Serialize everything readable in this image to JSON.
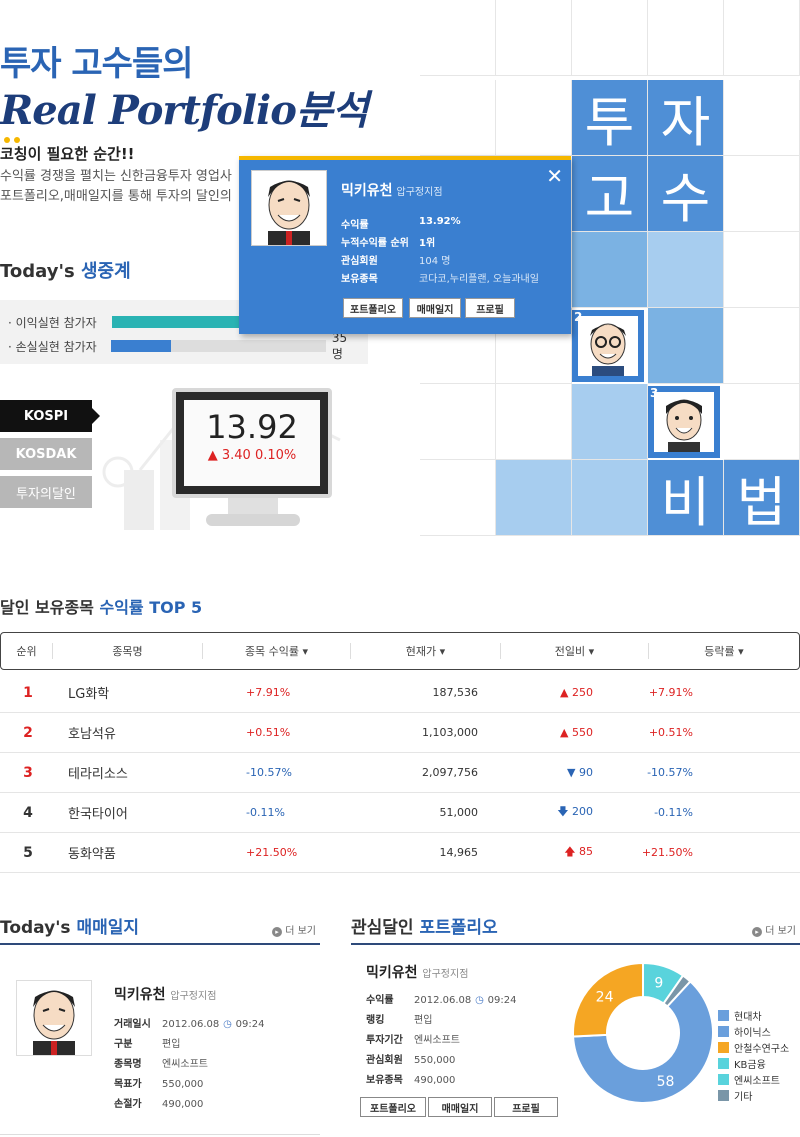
{
  "hero": {
    "title_line1": "투자 고수들의",
    "title_line2": "Real Portfolio분석",
    "coaching": "코칭이 필요한 순간!!",
    "intro_line1": "수익률 경쟁을 펼치는 신한금융투자 영업사",
    "intro_line2": "포트폴리오,매매일지를 통해 투자의 달인의"
  },
  "today_live": {
    "title_prefix": "Today's",
    "title_accent": "생중계",
    "profit_label": "· 이익실현 참가자",
    "loss_label": "· 손실실현 참가자",
    "loss_count": "35명",
    "profit_ratio": 0.6,
    "loss_ratio": 0.28
  },
  "market": {
    "tabs": [
      "KOSPI",
      "KOSDAK",
      "투자의달인"
    ],
    "active_tab": "KOSPI",
    "value": "13.92",
    "change": "▲ 3.40  0.10%"
  },
  "grid_chars": [
    "투",
    "자",
    "고",
    "수",
    "비",
    "법"
  ],
  "rank_cards": [
    {
      "num": "2"
    },
    {
      "num": "3"
    }
  ],
  "popup": {
    "name": "믹키유천",
    "branch": "압구정지점",
    "rows": [
      {
        "k": "수익률",
        "v": "13.92%"
      },
      {
        "k": "누적수익률 순위",
        "v": "1위"
      },
      {
        "k": "관심회원",
        "v": "104 명"
      },
      {
        "k": "보유종목",
        "v": "코다코,누리플랜, 오늘과내일"
      }
    ],
    "buttons": [
      "포트폴리오",
      "매매일지",
      "프로필"
    ]
  },
  "top5": {
    "title_prefix": "달인 보유종목",
    "title_accent": "수익률 TOP 5",
    "headers": [
      "순위",
      "종목명",
      "종목 수익률 ▾",
      "현재가 ▾",
      "전일비 ▾",
      "등락률 ▾"
    ],
    "rows": [
      {
        "rank": "1",
        "name": "LG화학",
        "ret": "+7.91%",
        "price": "187,536",
        "diff": "▲ 250",
        "rate": "+7.91%"
      },
      {
        "rank": "2",
        "name": "호남석유",
        "ret": "+0.51%",
        "price": "1,103,000",
        "diff": "▲ 550",
        "rate": "+0.51%"
      },
      {
        "rank": "3",
        "name": "테라리소스",
        "ret": "-10.57%",
        "price": "2,097,756",
        "diff": "▼ 90",
        "rate": "-10.57%"
      },
      {
        "rank": "4",
        "name": "한국타이어",
        "ret": "-0.11%",
        "price": "51,000",
        "diff": "🡇 200",
        "rate": "-0.11%"
      },
      {
        "rank": "5",
        "name": "동화약품",
        "ret": "+21.50%",
        "price": "14,965",
        "diff": "🡅 85",
        "rate": "+21.50%"
      }
    ]
  },
  "trade_log": {
    "title_prefix": "Today's",
    "title_accent": "매매일지",
    "more": "더 보기",
    "name": "믹키유천",
    "branch": "압구정지점",
    "rows": [
      {
        "k": "거래일시",
        "v": "2012.06.08",
        "t": "09:24"
      },
      {
        "k": "구분",
        "v": "편입"
      },
      {
        "k": "종목명",
        "v": "엔씨소프트"
      },
      {
        "k": "목표가",
        "v": "550,000"
      },
      {
        "k": "손절가",
        "v": "490,000"
      }
    ]
  },
  "portfolio": {
    "title_prefix": "관심달인",
    "title_accent": "포트폴리오",
    "more": "더 보기",
    "name": "믹키유천",
    "branch": "압구정지점",
    "rows": [
      {
        "k": "수익률",
        "v": "2012.06.08",
        "t": "09:24"
      },
      {
        "k": "랭킹",
        "v": "편입"
      },
      {
        "k": "투자기간",
        "v": "엔씨소프트"
      },
      {
        "k": "관심회원",
        "v": "550,000"
      },
      {
        "k": "보유종목",
        "v": "490,000"
      }
    ],
    "buttons": [
      "포트폴리오",
      "매매일지",
      "프로필"
    ]
  },
  "chart_data": {
    "type": "pie",
    "title": "",
    "slices": [
      {
        "label": "현대차",
        "value": 58,
        "color": "#6a9fdc",
        "shown": "58"
      },
      {
        "label": "하이닉스",
        "value": 0,
        "color": "#6a9fdc",
        "shown": ""
      },
      {
        "label": "안철수연구소",
        "value": 24,
        "color": "#f5a623",
        "shown": "24"
      },
      {
        "label": "KB금융",
        "value": 0,
        "color": "#59d3dc",
        "shown": ""
      },
      {
        "label": "엔씨소프트",
        "value": 9,
        "color": "#59d3dc",
        "shown": "9"
      },
      {
        "label": "기타",
        "value": 2,
        "color": "#7a96a8",
        "shown": ""
      }
    ],
    "legend": [
      "현대차",
      "하이닉스",
      "안철수연구소",
      "KB금융",
      "엔씨소프트",
      "기타"
    ],
    "legend_colors": [
      "#6a9fdc",
      "#6a9fdc",
      "#f5a623",
      "#59d3dc",
      "#59d3dc",
      "#7a96a8"
    ]
  }
}
